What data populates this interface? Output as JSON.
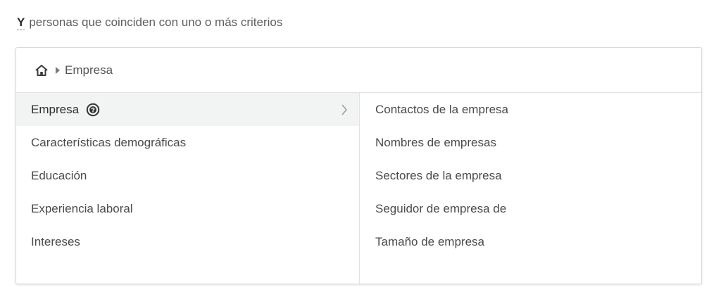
{
  "header": {
    "operator": "Y",
    "text": "personas que coinciden con uno o más criterios"
  },
  "breadcrumb": {
    "home_icon": "home-icon",
    "separator_icon": "caret-right-icon",
    "current": "Empresa"
  },
  "categories": [
    {
      "label": "Empresa",
      "active": true,
      "icon": "help-icon"
    },
    {
      "label": "Características demográficas"
    },
    {
      "label": "Educación"
    },
    {
      "label": "Experiencia laboral"
    },
    {
      "label": "Intereses"
    }
  ],
  "subcategories": [
    {
      "label": "Contactos de la empresa"
    },
    {
      "label": "Nombres de empresas"
    },
    {
      "label": "Sectores de la empresa"
    },
    {
      "label": "Seguidor de empresa de"
    },
    {
      "label": "Tamaño de empresa"
    }
  ],
  "colors": {
    "active_row_bg": "#f2f4f3",
    "border": "#d9d9d9"
  }
}
